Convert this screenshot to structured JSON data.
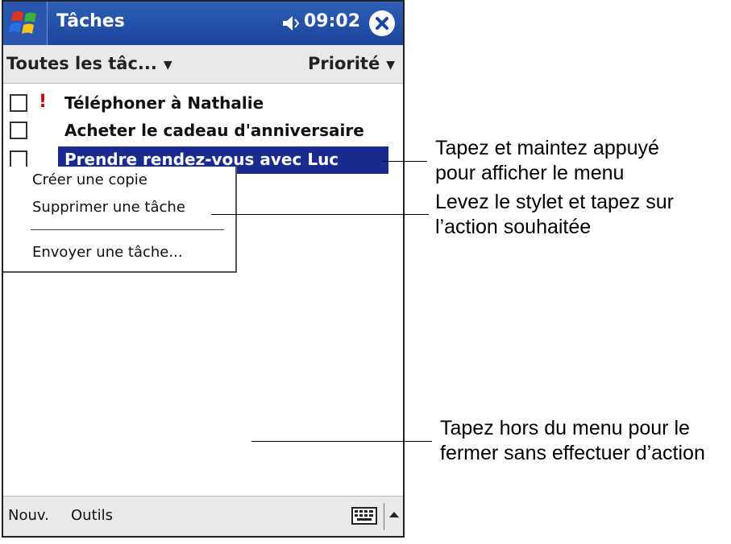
{
  "window": {
    "app_title": "Tâches",
    "clock": "09:02"
  },
  "filter_bar": {
    "category": "Toutes les tâc...",
    "sort": "Priorité"
  },
  "tasks": [
    {
      "label": "Téléphoner à Nathalie",
      "priority": "!",
      "checked": false,
      "selected": false
    },
    {
      "label": "Acheter le cadeau d'anniversaire",
      "priority": "",
      "checked": false,
      "selected": false
    },
    {
      "label": "Prendre rendez-vous avec Luc",
      "priority": "",
      "checked": false,
      "selected": true
    }
  ],
  "context_menu": {
    "items": [
      "Créer une copie",
      "Supprimer une tâche",
      "Envoyer une tâche..."
    ]
  },
  "bottom_bar": {
    "menu_new": "Nouv.",
    "menu_tools": "Outils"
  },
  "callouts": [
    "Tapez et maintez appuyé\npour afficher le menu",
    "Levez le stylet et tapez sur\nl’action souhaitée",
    "Tapez hors du menu pour le\nfermer sans effectuer d’action"
  ],
  "colors": {
    "titlebar": "#1c449c",
    "selection": "#1a2b8f",
    "priority": "#c30000"
  }
}
